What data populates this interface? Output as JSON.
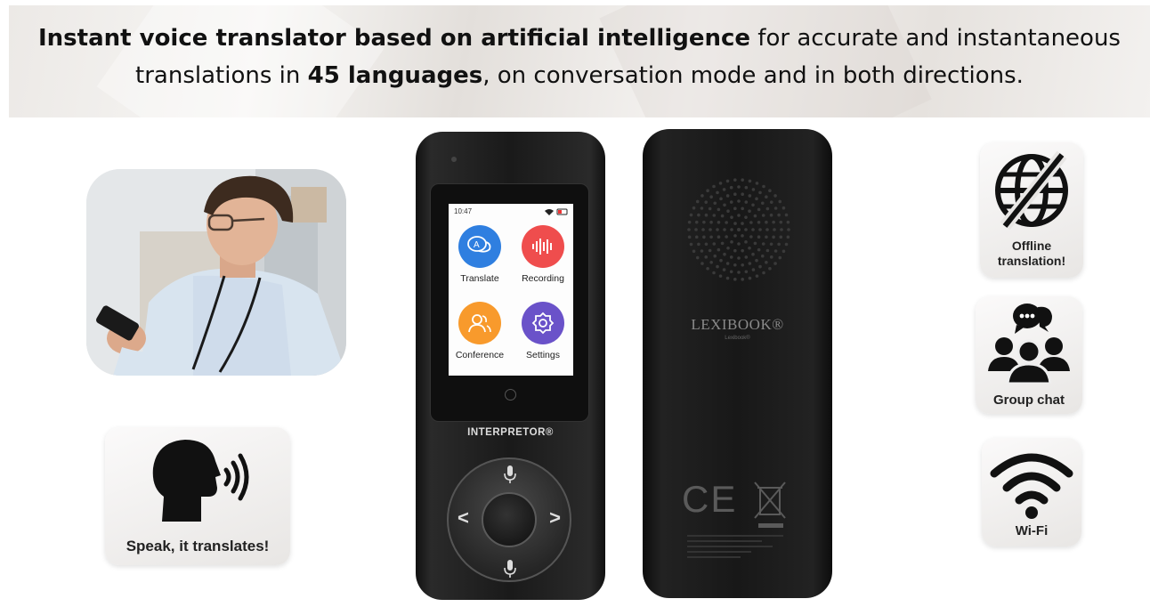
{
  "banner": {
    "line1_bold": "Instant voice translator based on artificial intelligence",
    "line1_rest": " for accurate and instantaneous",
    "line2_pre": "translations in ",
    "line2_bold": "45 languages",
    "line2_post": ", on conversation mode and in both directions."
  },
  "device_front": {
    "status_time": "10:47",
    "apps": [
      {
        "label": "Translate",
        "color": "#2f7fe0"
      },
      {
        "label": "Recording",
        "color": "#ef4d4d"
      },
      {
        "label": "Conference",
        "color": "#f89a2c"
      },
      {
        "label": "Settings",
        "color": "#6a52c9"
      }
    ],
    "brand": "INTERPRETOR®",
    "nav_left": "<",
    "nav_right": ">"
  },
  "device_back": {
    "brand": "LEXIBOOK®",
    "sub_brand": "Lexibook®",
    "ce_mark": "CE"
  },
  "features": {
    "speak": "Speak, it translates!",
    "offline": "Offline translation!",
    "group": "Group chat",
    "wifi": "Wi-Fi"
  },
  "icons": [
    "globe-slash-icon",
    "group-chat-icon",
    "wifi-icon",
    "speaking-head-icon",
    "microphone-icon",
    "home-button-icon",
    "speaker-grille-icon",
    "weee-bin-icon"
  ]
}
